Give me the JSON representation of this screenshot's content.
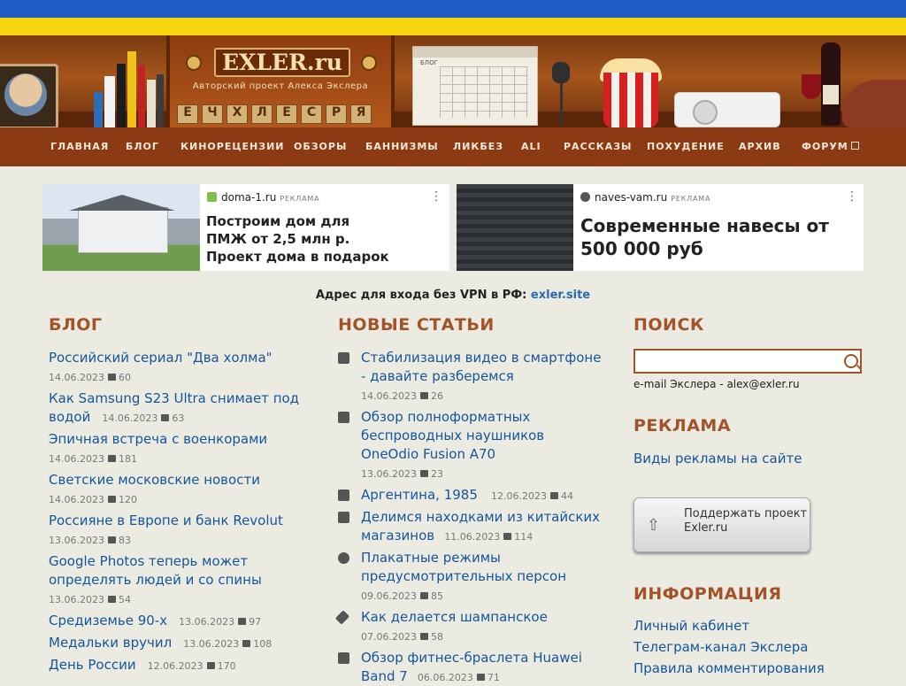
{
  "header": {
    "logo_title": "EXLER.ru",
    "logo_subtitle": "Авторский проект Алекса Экслера",
    "calendar_label": "БЛОГ"
  },
  "nav": [
    {
      "label": "ГЛАВНАЯ"
    },
    {
      "label": "БЛОГ"
    },
    {
      "label": "КИНОРЕЦЕНЗИИ"
    },
    {
      "label": "ОБЗОРЫ"
    },
    {
      "label": "БАННИЗМЫ"
    },
    {
      "label": "ЛИКБЕЗ"
    },
    {
      "label": "ALI"
    },
    {
      "label": "РАССКАЗЫ"
    },
    {
      "label": "ПОХУДЕНИЕ"
    },
    {
      "label": "АРХИВ"
    },
    {
      "label": "ФОРУМ"
    }
  ],
  "ads": [
    {
      "source": "doma-1.ru",
      "tag": "РЕКЛАМА",
      "text": "Построим дом для ПМЖ от 2,5 млн р. Проект дома в подарок"
    },
    {
      "source": "naves-vam.ru",
      "tag": "РЕКЛАМА",
      "text": "Современные навесы от 500 000 руб"
    }
  ],
  "vpn": {
    "prefix": "Адрес для входа без VPN в РФ:",
    "link": "exler.site"
  },
  "blog": {
    "heading": "БЛОГ",
    "items": [
      {
        "title": "Российский сериал \"Два холма\"",
        "date": "14.06.2023",
        "comments": "60"
      },
      {
        "title": "Как Samsung S23 Ultra снимает под водой",
        "date": "14.06.2023",
        "comments": "63"
      },
      {
        "title": "Эпичная встреча с военкорами",
        "date": "14.06.2023",
        "comments": "181"
      },
      {
        "title": "Светские московские новости",
        "date": "14.06.2023",
        "comments": "120"
      },
      {
        "title": "Россияне в Европе и банк Revolut",
        "date": "13.06.2023",
        "comments": "83"
      },
      {
        "title": "Google Photos теперь может определять людей и со спины",
        "date": "13.06.2023",
        "comments": "54"
      },
      {
        "title": "Средиземье 90-х",
        "date": "13.06.2023",
        "comments": "97"
      },
      {
        "title": "Медальки вручил",
        "date": "13.06.2023",
        "comments": "108"
      },
      {
        "title": "День России",
        "date": "12.06.2023",
        "comments": "170"
      }
    ]
  },
  "articles": {
    "heading": "НОВЫЕ СТАТЬИ",
    "items": [
      {
        "title": "Стабилизация видео в смартфоне - давайте разберемся",
        "date": "14.06.2023",
        "comments": "26",
        "icon": "question-icon"
      },
      {
        "title": "Обзор полноформатных беспроводных наушников OneOdio Fusion A70",
        "date": "13.06.2023",
        "comments": "23",
        "icon": "checklist-icon"
      },
      {
        "title": "Аргентина, 1985",
        "date": "12.06.2023",
        "comments": "44",
        "icon": "clapperboard-icon"
      },
      {
        "title": "Делимся находками из китайских магазинов",
        "date": "11.06.2023",
        "comments": "114",
        "icon": "question-icon"
      },
      {
        "title": "Плакатные режимы предусмотрительных персон",
        "date": "09.06.2023",
        "comments": "85",
        "icon": "smiley-icon"
      },
      {
        "title": "Как делается шампанское",
        "date": "07.06.2023",
        "comments": "58",
        "icon": "pencil-icon"
      },
      {
        "title": "Обзор фитнес-браслета Huawei Band 7",
        "date": "06.06.2023",
        "comments": "71",
        "icon": "checklist-icon"
      }
    ]
  },
  "sidebar": {
    "search_heading": "ПОИСК",
    "search_value": "",
    "email": "e-mail Экслера - alex@exler.ru",
    "ads_heading": "РЕКЛАМА",
    "ads_link": "Виды рекламы на сайте",
    "support_button": "Поддержать проект Exler.ru",
    "info_heading": "ИНФОРМАЦИЯ",
    "info_links": [
      "Личный кабинет",
      "Телеграм-канал Экслера",
      "Правила комментирования"
    ]
  },
  "colors": {
    "accent": "#a3532a",
    "link": "#15559a",
    "nav_bg": "#8b3a14",
    "page_bg": "#ecebe2"
  }
}
